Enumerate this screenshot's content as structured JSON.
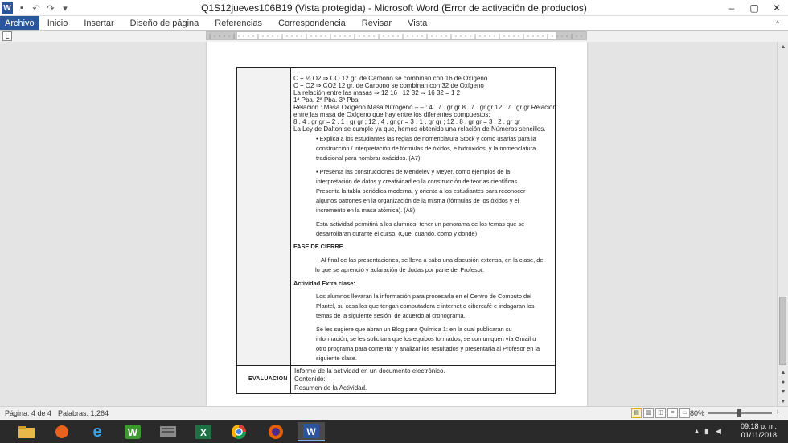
{
  "window": {
    "title": "Q1S12jueves106B19 (Vista protegida)  -  Microsoft Word (Error de activación de productos)",
    "app_icon_label": "W",
    "controls": {
      "minimize": "–",
      "restore": "▢",
      "close": "✕"
    }
  },
  "ribbon": {
    "tabs": [
      "Archivo",
      "Inicio",
      "Insertar",
      "Diseño de página",
      "Referencias",
      "Correspondencia",
      "Revisar",
      "Vista"
    ],
    "collapse_icon": "^"
  },
  "ruler": {
    "tab_selector_label": "L"
  },
  "document": {
    "chem_lines": [
      " C + ½ O2 ⇒ CO 12 gr. de Carbono se combinan con 16 de Oxígeno",
      "C + O2 ⇒ CO2 12 gr. de Carbono se combinan con 32 de Oxígeno",
      "La relación entre las masas ⇒ 12 16 ; 12 32 ⇒ 16 32 = 1 2",
      "1ª Pba. 2ª Pba. 3ª Pba.",
      " Relación : Masa Oxígeno Masa Nitrógeno – – : 4 . 7 . gr gr 8 . 7 . gr gr 12 . 7 . gr gr Relación",
      "entre las masa de Oxígeno que hay entre los diferentes compuestos:",
      "8 . 4 . gr gr = 2 . 1 . gr gr ; 12 . 4 . gr gr = 3 . 1 . gr gr ; 12 . 8 . gr gr = 3 . 2 . gr gr",
      "La Ley de Dalton se cumple ya que, hemos obtenido una relación de Números sencillos."
    ],
    "bullet1": [
      "• Explica a los estudiantes las reglas de nomenclatura Stock y cómo usarlas para la",
      "construcción / interpretación de fórmulas de óxidos, e hidróxidos, y la nomenclatura",
      "tradicional para nombrar oxácidos. (A7)"
    ],
    "bullet2": [
      "• Presenta las construcciones de Mendelev y Meyer, como ejemplos de la",
      "interpretación de datos y creatividad en la construcción de teorías científicas.",
      "Presenta la tabla periódica moderna, y orienta a los estudiantes para reconocer",
      "algunos patrones en la organización de la misma (fórmulas de los óxidos y el",
      "incremento en la masa atómica). (A8)"
    ],
    "activity_note": [
      "Esta actividad permitirá a los alumnos, tener un panorama de los temas que se",
      "desarrollaran durante el curso. (Que, cuando, como y donde)"
    ],
    "closing_heading": "FASE DE CIERRE",
    "closing_text": [
      "Al final de las presentaciones, se lleva a cabo una discusión extensa, en la clase, de",
      "lo  que se aprendió y aclaración de dudas por parte del Profesor."
    ],
    "extra_heading": "Actividad Extra clase:",
    "extra_text1": [
      "Los alumnos llevaran la información  para procesarla en el Centro de Computo del",
      "Plantel, su casa los que tengan computadora e internet o cibercafé e indagaran los",
      "temas de la siguiente sesión, de acuerdo al cronograma."
    ],
    "extra_text2": [
      "Se les sugiere que abran un Blog para Química 1: en la cual publicaran su",
      "información, se les solicitara que los equipos formados, se comuniquen vía Gmail u",
      "otro programa para comentar y analizar los resultados y presentarla al Profesor en la",
      "siguiente clase."
    ],
    "evaluation_label": "EVALUACIÓN",
    "evaluation_lines": [
      "Informe de la actividad en un documento electrónico.",
      "   Contenido:",
      "  Resumen de la Actividad."
    ]
  },
  "statusbar": {
    "page": "Página: 4 de 4",
    "words": "Palabras: 1,264",
    "zoom": "80%",
    "zoom_minus": "−",
    "zoom_plus": "+",
    "zoom_level": 0.8
  },
  "taskbar": {
    "apps": [
      "file-explorer",
      "app-orange",
      "internet-explorer",
      "app-green-w",
      "app-gray",
      "excel",
      "chrome",
      "firefox",
      "word"
    ],
    "clock_time": "09:18 p. m.",
    "clock_date": "01/11/2018"
  },
  "colors": {
    "word_blue": "#2b579a",
    "taskbar": "#2a2a2a",
    "page": "#ffffff"
  }
}
